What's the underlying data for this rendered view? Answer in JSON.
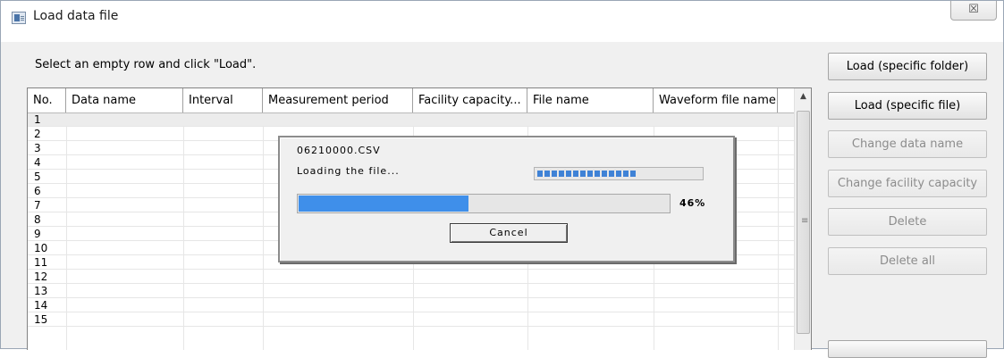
{
  "window": {
    "title": "Load data file",
    "close_glyph": "☒"
  },
  "instruction": "Select an empty row and click \"Load\".",
  "table": {
    "columns": [
      "No.",
      "Data name",
      "Interval",
      "Measurement period",
      "Facility capacity...",
      "File name",
      "Waveform file name"
    ],
    "rows": [
      "1",
      "2",
      "3",
      "4",
      "5",
      "6",
      "7",
      "8",
      "9",
      "10",
      "11",
      "12",
      "13",
      "14",
      "15"
    ]
  },
  "buttons": {
    "load_folder": "Load (specific folder)",
    "load_file": "Load (specific file)",
    "change_name": "Change data name",
    "change_capacity": "Change facility capacity",
    "delete": "Delete",
    "delete_all": "Delete all"
  },
  "progress_dialog": {
    "file_name": "06210000.CSV",
    "status": "Loading the file...",
    "percent_value": 46,
    "percent_label": "46%",
    "cancel_label": "Cancel"
  },
  "colors": {
    "progress": "#3f8fea",
    "marquee": "#3f82d6"
  }
}
